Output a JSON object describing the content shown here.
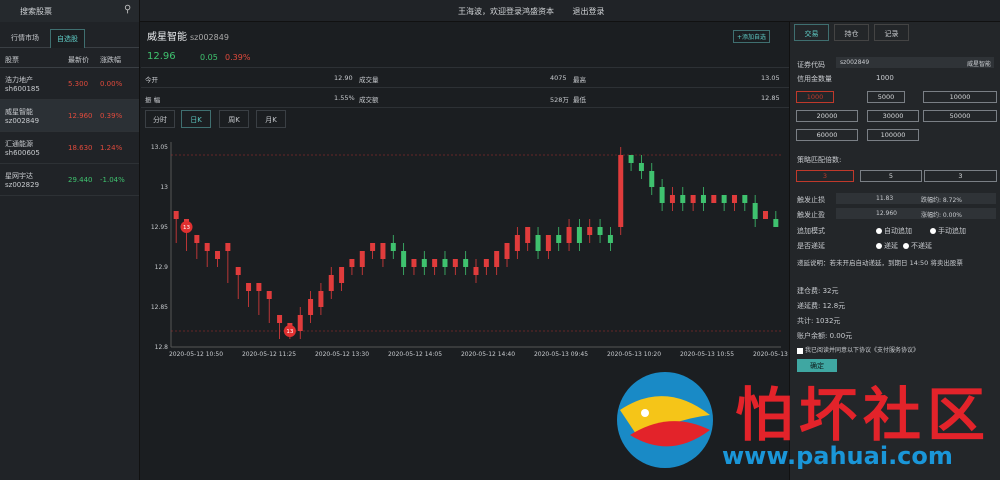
{
  "topbar": {
    "search_label": "搜索股票",
    "user_text": "王海波，欢迎登录鸿盛资本",
    "logout": "退出登录"
  },
  "left": {
    "tabs": [
      "行情市场",
      "自选股"
    ],
    "headers": [
      "股票",
      "最新价",
      "涨跌幅"
    ],
    "stocks": [
      {
        "name": "浩力地产",
        "code": "sh600185",
        "price": "5.300",
        "change": "0.00%",
        "color": "red"
      },
      {
        "name": "威星智能",
        "code": "sz002849",
        "price": "12.960",
        "change": "0.39%",
        "color": "red"
      },
      {
        "name": "汇通能源",
        "code": "sh600605",
        "price": "18.630",
        "change": "1.24%",
        "color": "red"
      },
      {
        "name": "星网宇达",
        "code": "sz002829",
        "price": "29.440",
        "change": "-1.04%",
        "color": "green"
      }
    ]
  },
  "main": {
    "title": "威星智能",
    "code": "sz002849",
    "add_btn": "+添加自选",
    "price": "12.96",
    "change": "0.05",
    "change_pct": "0.39%",
    "quote": [
      [
        "今开",
        "12.90",
        "成交量",
        "4075",
        "最高",
        "13.05"
      ],
      [
        "振 幅",
        "1.55%",
        "成交额",
        "528万",
        "最低",
        "12.85"
      ]
    ],
    "tabs": [
      "分时",
      "日K",
      "周K",
      "月K"
    ]
  },
  "chart_data": {
    "type": "candlestick",
    "y_ticks": [
      "13.05",
      "13",
      "12.95",
      "12.9",
      "12.85",
      "12.8"
    ],
    "ylim": [
      12.8,
      13.05
    ],
    "x_ticks": [
      "2020-05-12 10:50",
      "2020-05-12 11:25",
      "2020-05-12 13:30",
      "2020-05-12 14:05",
      "2020-05-12 14:40",
      "2020-05-13 09:45",
      "2020-05-13 10:20",
      "2020-05-13 10:55",
      "2020-05-13 11:30"
    ],
    "markers": [
      "13",
      "13"
    ],
    "up_color": "#e03c3c",
    "down_color": "#3fc26f",
    "candles": [
      [
        12.96,
        12.97,
        12.94,
        12.93
      ],
      [
        12.95,
        12.96,
        12.93,
        12.92
      ],
      [
        12.93,
        12.94,
        12.92,
        12.91
      ],
      [
        12.92,
        12.93,
        12.91,
        12.9
      ],
      [
        12.91,
        12.92,
        12.91,
        12.9
      ],
      [
        12.92,
        12.93,
        12.89,
        12.88
      ],
      [
        12.89,
        12.9,
        12.87,
        12.86
      ],
      [
        12.87,
        12.88,
        12.86,
        12.85
      ],
      [
        12.87,
        12.88,
        12.85,
        12.84
      ],
      [
        12.86,
        12.87,
        12.84,
        12.83
      ],
      [
        12.83,
        12.84,
        12.82,
        12.81
      ],
      [
        12.82,
        12.83,
        12.82,
        12.81
      ],
      [
        12.82,
        12.84,
        12.85,
        12.81
      ],
      [
        12.84,
        12.86,
        12.87,
        12.83
      ],
      [
        12.85,
        12.87,
        12.88,
        12.84
      ],
      [
        12.87,
        12.89,
        12.9,
        12.86
      ],
      [
        12.88,
        12.9,
        12.9,
        12.87
      ],
      [
        12.9,
        12.91,
        12.91,
        12.89
      ],
      [
        12.9,
        12.92,
        12.92,
        12.89
      ],
      [
        12.92,
        12.93,
        12.93,
        12.91
      ],
      [
        12.91,
        12.93,
        12.93,
        12.9
      ],
      [
        12.93,
        12.92,
        12.94,
        12.91
      ],
      [
        12.92,
        12.9,
        12.93,
        12.89
      ],
      [
        12.9,
        12.91,
        12.91,
        12.89
      ],
      [
        12.91,
        12.9,
        12.92,
        12.89
      ],
      [
        12.9,
        12.91,
        12.91,
        12.89
      ],
      [
        12.91,
        12.9,
        12.92,
        12.89
      ],
      [
        12.9,
        12.91,
        12.91,
        12.89
      ],
      [
        12.91,
        12.9,
        12.92,
        12.89
      ],
      [
        12.89,
        12.9,
        12.91,
        12.88
      ],
      [
        12.9,
        12.91,
        12.91,
        12.89
      ],
      [
        12.9,
        12.92,
        12.92,
        12.89
      ],
      [
        12.91,
        12.93,
        12.93,
        12.9
      ],
      [
        12.92,
        12.94,
        12.95,
        12.91
      ],
      [
        12.93,
        12.95,
        12.95,
        12.92
      ],
      [
        12.94,
        12.92,
        12.95,
        12.91
      ],
      [
        12.92,
        12.94,
        12.94,
        12.91
      ],
      [
        12.94,
        12.93,
        12.95,
        12.92
      ],
      [
        12.93,
        12.95,
        12.96,
        12.92
      ],
      [
        12.95,
        12.93,
        12.96,
        12.92
      ],
      [
        12.94,
        12.95,
        12.96,
        12.93
      ],
      [
        12.95,
        12.94,
        12.96,
        12.93
      ],
      [
        12.94,
        12.93,
        12.95,
        12.92
      ],
      [
        12.95,
        13.04,
        13.05,
        12.94
      ],
      [
        13.04,
        13.03,
        13.04,
        13.02
      ],
      [
        13.03,
        13.02,
        13.04,
        13.01
      ],
      [
        13.02,
        13.0,
        13.03,
        12.99
      ],
      [
        13.0,
        12.98,
        13.01,
        12.97
      ],
      [
        12.98,
        12.99,
        13.0,
        12.97
      ],
      [
        12.99,
        12.98,
        13.0,
        12.97
      ],
      [
        12.98,
        12.99,
        12.99,
        12.97
      ],
      [
        12.99,
        12.98,
        13.0,
        12.97
      ],
      [
        12.98,
        12.99,
        12.99,
        12.98
      ],
      [
        12.99,
        12.98,
        12.99,
        12.97
      ],
      [
        12.98,
        12.99,
        12.99,
        12.97
      ],
      [
        12.99,
        12.98,
        12.99,
        12.97
      ],
      [
        12.98,
        12.96,
        12.99,
        12.95
      ],
      [
        12.96,
        12.97,
        12.97,
        12.96
      ],
      [
        12.96,
        12.95,
        12.97,
        12.95
      ]
    ]
  },
  "right": {
    "tabs": [
      "交易",
      "持仓",
      "记录"
    ],
    "code_label": "证券代码",
    "code_value": "sz002849",
    "code_name": "威星智能",
    "credit_label": "信用金数量",
    "credit_value": "1000",
    "amounts": [
      "1000",
      "5000",
      "10000",
      "20000",
      "30000",
      "50000",
      "60000",
      "100000"
    ],
    "multiple_label": "策略匹配倍数:",
    "multiples": [
      "3",
      "5",
      "3"
    ],
    "stop_loss_label": "触发止损",
    "stop_loss": "11.83",
    "stop_loss_pct": "跌幅约: 8.72%",
    "stop_profit_label": "触发止盈",
    "stop_profit": "12.960",
    "stop_profit_pct": "涨幅约: 0.00%",
    "add_mode_label": "追加模式",
    "add_auto": "自动追加",
    "add_manual": "手动追加",
    "defer_label": "是否递延",
    "defer_yes": "递延",
    "defer_no": "不递延",
    "note": "递延说明：若未开启自动递延，到期日 14:50 将卖出股票",
    "fee1": "建仓费:    32元",
    "fee2": "递延费:    12.8元",
    "total": "共计:    1032元",
    "balance": "账户余额:    0.00元",
    "agree": "我已阅读并同意以下协议",
    "agree_link": "《支付服务协议》",
    "confirm": "确定"
  },
  "watermark": {
    "text": "怕坏社区",
    "url": "www.pahuai.com"
  }
}
